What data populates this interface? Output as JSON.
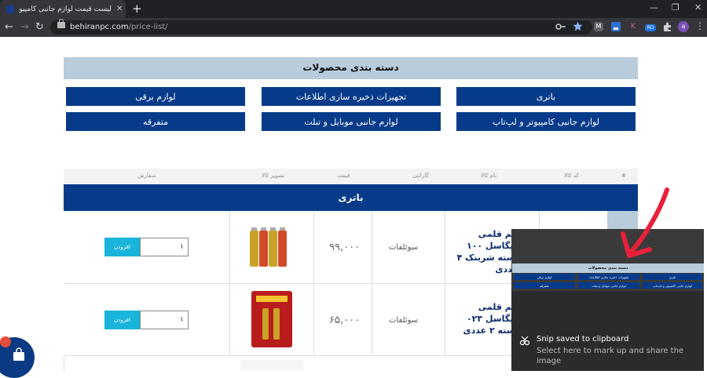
{
  "browser": {
    "tab_title": "لیست قیمت لوازم جانبی کامپیوتر و",
    "tab_close": "✕",
    "new_tab": "+",
    "url_domain": "behiranpc.com",
    "url_path": "/price-list/",
    "window_controls": [
      "—",
      "❐",
      "✕"
    ],
    "nav": {
      "back": "←",
      "forward": "→",
      "reload": "↻"
    },
    "extensions": [
      {
        "label": "M",
        "color": "#5f6368"
      },
      {
        "label": "K",
        "color": "#35363a"
      },
      {
        "label": "RD",
        "color": "#1a73e8"
      }
    ],
    "profile": "a"
  },
  "categories": {
    "title": "دسته بندی محصولات",
    "items": [
      "باتری",
      "تجهیزات ذخیره سازی اطلاعات",
      "لوازم برقی",
      "لوازم جانبی کامپیوتر و لپ‌تاپ",
      "لوازم جانبی موبایل و تبلت",
      "متفرقه"
    ]
  },
  "table": {
    "headers": [
      "#",
      "کد کالا",
      "نام کالا",
      "گارانتی",
      "قیمت",
      "تصویر کالا",
      "سفارش"
    ],
    "category_row": "باتری",
    "rows": [
      {
        "name": "نیم قلمی گیگاسل ۱۰۰ بسته شرینک ۴ عددی",
        "warranty": "سوئلفات",
        "price": "۹۹,۰۰۰",
        "qty": "۱",
        "add_label": "افزودن"
      },
      {
        "name": "نیم قلمی گیگاسل ۰۲۳ بسته ۲ عددی",
        "warranty": "سوئلفات",
        "price": "۶۵,۰۰۰",
        "qty": "۱",
        "add_label": "افزودن"
      }
    ]
  },
  "snip": {
    "title": "Snip saved to clipboard",
    "subtitle": "Select here to mark up and share the image",
    "preview_title": "دسته بندی محصولات"
  },
  "cart": {
    "badge": "۰"
  },
  "colors": {
    "brand": "#073b8a",
    "accent": "#18b4d9",
    "category_bg": "#b8ccdc",
    "arrow": "#e8213b"
  }
}
